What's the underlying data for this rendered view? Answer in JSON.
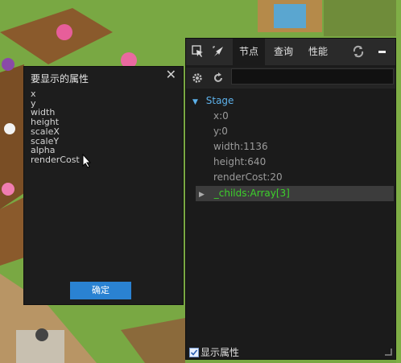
{
  "dialog": {
    "title": "要显示的属性",
    "close_label": "✕",
    "properties": [
      "x",
      "y",
      "width",
      "height",
      "scaleX",
      "scaleY",
      "alpha",
      "renderCost"
    ],
    "confirm_label": "确定"
  },
  "panel": {
    "tabs": [
      {
        "label": "节点",
        "active": true
      },
      {
        "label": "查询",
        "active": false
      },
      {
        "label": "性能",
        "active": false
      }
    ],
    "tree": {
      "root": "Stage",
      "props": [
        "x:0",
        "y:0",
        "width:1136",
        "height:640",
        "renderCost:20"
      ],
      "child": "_childs:Array[3]"
    },
    "footer_label": "显示属性"
  },
  "colors": {
    "accent": "#2a82d2",
    "stage": "#5db1ea",
    "childs": "#3dd12b"
  }
}
